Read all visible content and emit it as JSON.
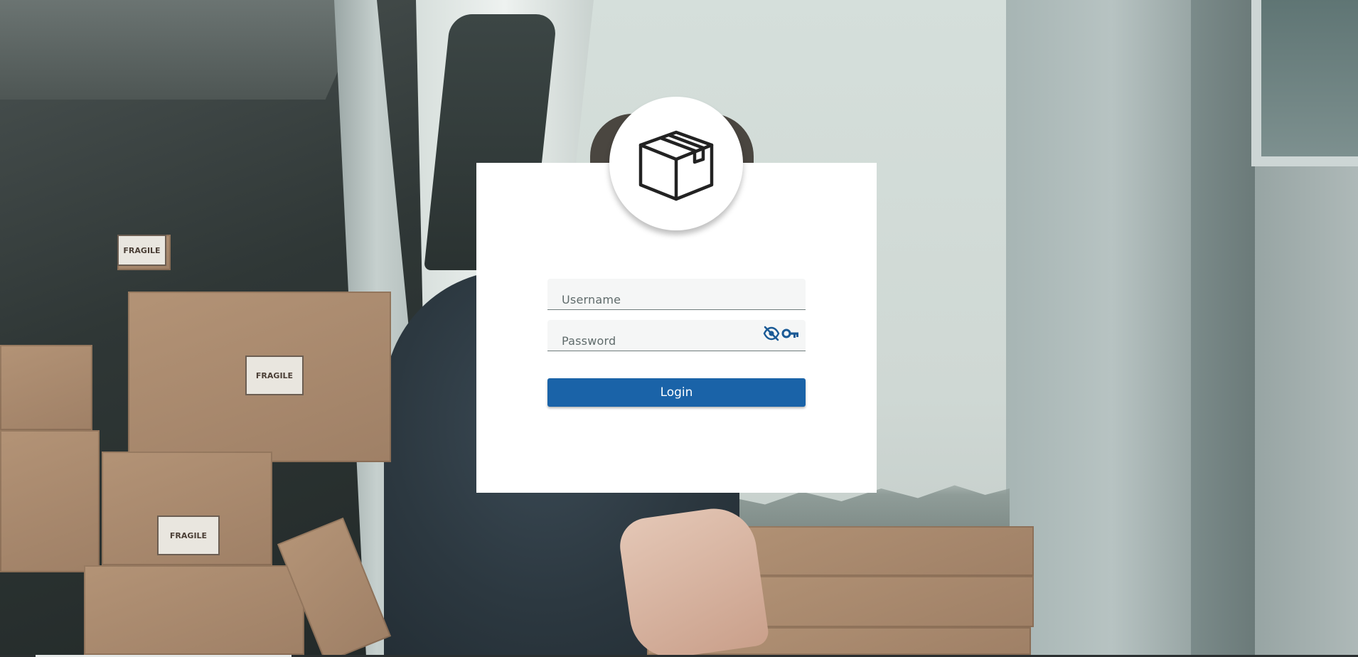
{
  "login_form": {
    "username_label": "Username",
    "password_label": "Password",
    "username_value": "",
    "password_value": "",
    "login_label": "Login"
  },
  "icons": {
    "logo": "package-box-icon",
    "password_visibility": "eye-off-icon",
    "password_key": "key-icon"
  },
  "background_labels": {
    "fragile": "FRAGILE"
  },
  "colors": {
    "accent": "#1a63a8",
    "card": "#ffffff",
    "field_bg": "#f5f6f6",
    "icon_blue": "#1a5a96",
    "logo_stroke": "#222222"
  }
}
